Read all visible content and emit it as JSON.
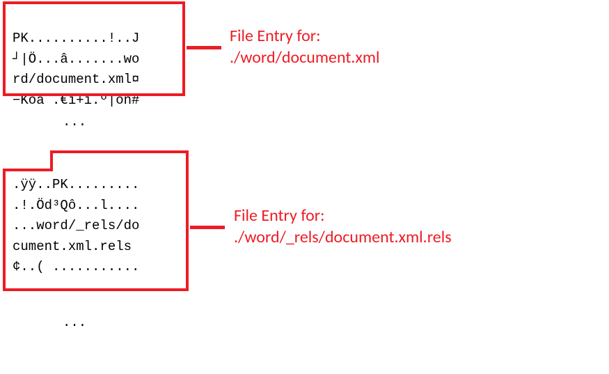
{
  "block1": {
    "line1": "PK..........!..J",
    "line2": "┘|Ö...â.......wo",
    "line3": "rd/document.xml¤",
    "line4": "−Koã .€ï+í.º|oñ#"
  },
  "ellipsis1": "...",
  "block2": {
    "line1": ".ÿÿ..PK.........",
    "line2": ".!.Öd³Qô...l....",
    "line3": "...word/_rels/do",
    "line4": "cument.xml.rels ",
    "line5": "¢..( ...........",
    "line6": "................"
  },
  "ellipsis2": "...",
  "label1": {
    "title": "File Entry for:",
    "path": "./word/document.xml"
  },
  "label2": {
    "title": "File Entry for:",
    "path": "./word/_rels/document.xml.rels"
  }
}
